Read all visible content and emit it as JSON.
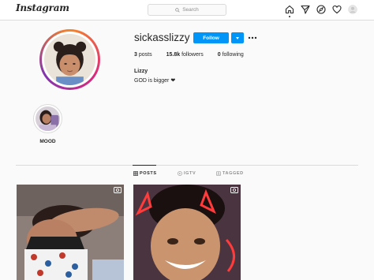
{
  "nav": {
    "logo": "Instagram",
    "search_placeholder": "Search",
    "icons": [
      "home-icon",
      "direct-icon",
      "explore-icon",
      "activity-icon",
      "profile-icon"
    ]
  },
  "profile": {
    "username": "sickasslizzy",
    "follow_label": "Follow",
    "stats": {
      "posts_count": "3",
      "posts_label": "posts",
      "followers_count": "15.8k",
      "followers_label": "followers",
      "following_count": "0",
      "following_label": "following"
    },
    "full_name": "Lizzy",
    "bio": "GOD is bigger",
    "bio_emoji": "❤"
  },
  "highlights": [
    {
      "label": "MOOD"
    }
  ],
  "tabs": [
    {
      "label": "POSTS",
      "active": true
    },
    {
      "label": "IGTV",
      "active": false
    },
    {
      "label": "TAGGED",
      "active": false
    }
  ],
  "posts": [
    {
      "type": "video",
      "icon": "video-icon"
    },
    {
      "type": "video",
      "icon": "video-icon"
    }
  ],
  "colors": {
    "accent": "#0095f6",
    "border": "#dbdbdb",
    "background": "#fafafa",
    "text": "#262626",
    "muted": "#8e8e8e"
  }
}
